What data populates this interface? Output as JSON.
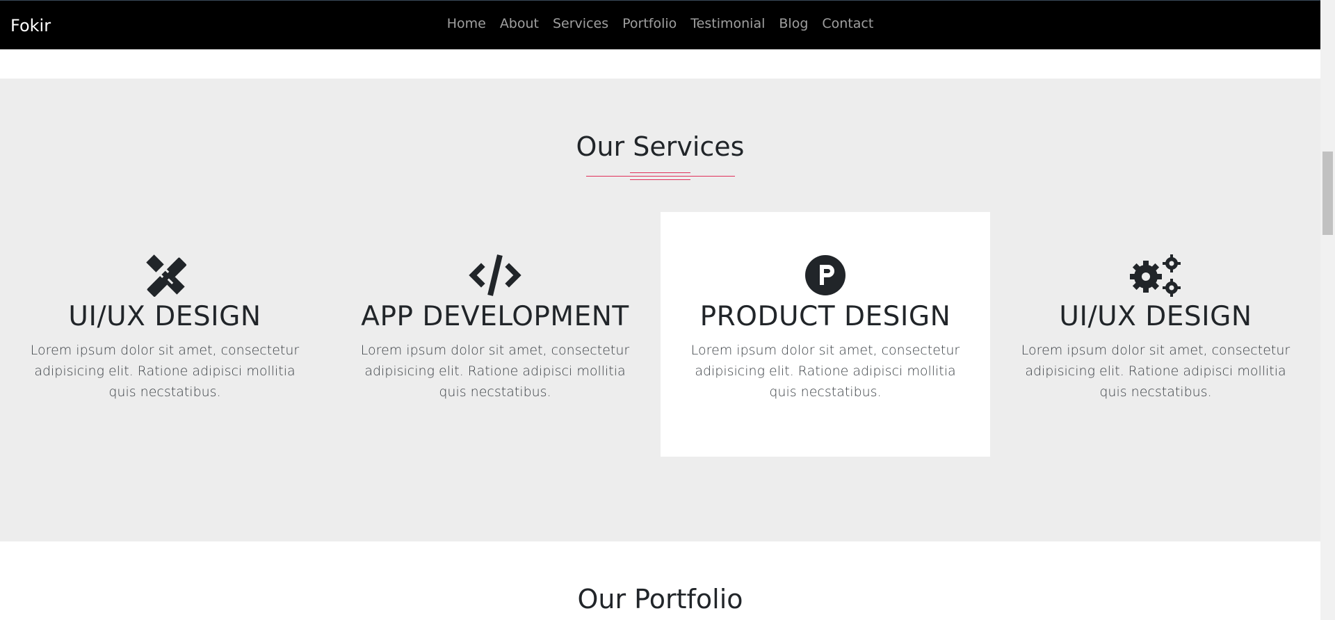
{
  "navbar": {
    "brand": "Fokir",
    "links": [
      "Home",
      "About",
      "Services",
      "Portfolio",
      "Testimonial",
      "Blog",
      "Contact"
    ]
  },
  "services": {
    "title": "Our Services",
    "cards": [
      {
        "icon": "pencil-ruler-icon",
        "title": "UI/UX DESIGN",
        "text": "Lorem ipsum dolor sit amet, consectetur adipisicing elit. Ratione adipisci mollitia quis necstatibus."
      },
      {
        "icon": "code-icon",
        "title": "APP DEVELOPMENT",
        "text": "Lorem ipsum dolor sit amet, consectetur adipisicing elit. Ratione adipisci mollitia quis necstatibus."
      },
      {
        "icon": "product-hunt-icon",
        "title": "PRODUCT DESIGN",
        "text": "Lorem ipsum dolor sit amet, consectetur adipisicing elit. Ratione adipisci mollitia quis necstatibus."
      },
      {
        "icon": "gears-icon",
        "title": "UI/UX DESIGN",
        "text": "Lorem ipsum dolor sit amet, consectetur adipisicing elit. Ratione adipisci mollitia quis necstatibus."
      }
    ]
  },
  "portfolio": {
    "title": "Our Portfolio"
  },
  "colors": {
    "navbar_bg": "#000000",
    "section_bg": "#ededed",
    "accent": "#e0305a",
    "text": "#212529"
  }
}
